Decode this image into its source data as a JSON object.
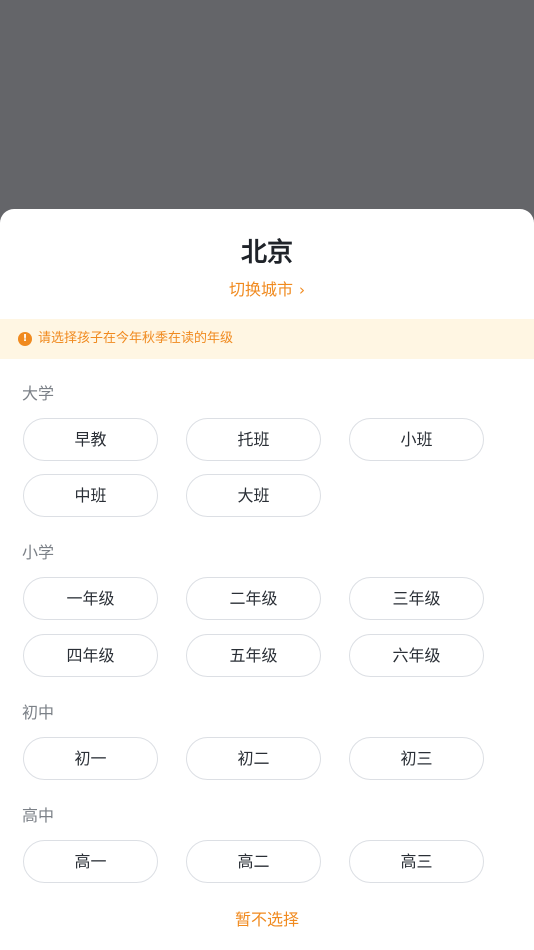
{
  "header": {
    "city": "北京",
    "switch_city_label": "切换城市",
    "switch_city_chevron": "›"
  },
  "notice": {
    "icon": "alert-circle-icon",
    "icon_glyph": "!",
    "text": "请选择孩子在今年秋季在读的年级"
  },
  "sections": [
    {
      "label": "大学",
      "options": [
        "早教",
        "托班",
        "小班",
        "中班",
        "大班"
      ]
    },
    {
      "label": "小学",
      "options": [
        "一年级",
        "二年级",
        "三年级",
        "四年级",
        "五年级",
        "六年级"
      ]
    },
    {
      "label": "初中",
      "options": [
        "初一",
        "初二",
        "初三"
      ]
    },
    {
      "label": "高中",
      "options": [
        "高一",
        "高二",
        "高三"
      ]
    }
  ],
  "footer": {
    "skip_label": "暂不选择"
  },
  "colors": {
    "accent": "#f08a1f",
    "overlay": "#646569",
    "notice_bg": "#fff6e3"
  }
}
